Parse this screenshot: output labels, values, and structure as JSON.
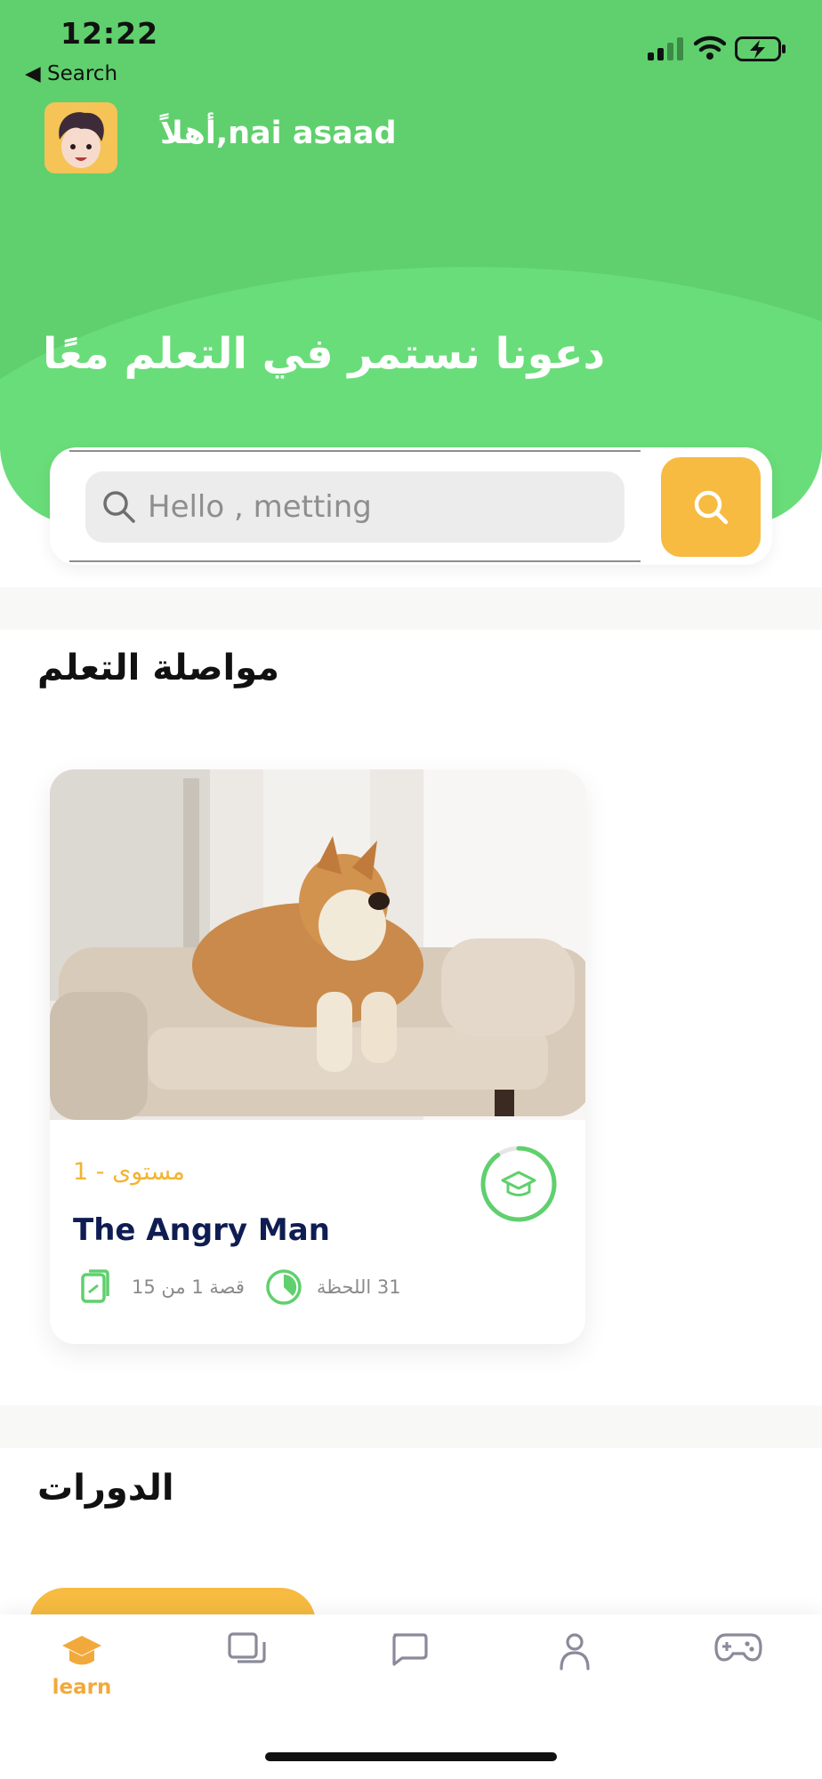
{
  "status_bar": {
    "time": "12:22",
    "back_label": "◀ Search"
  },
  "header": {
    "greeting": "أهلاً,nai asaad",
    "title": "دعونا نستمر في التعلم معًا"
  },
  "search": {
    "placeholder": "Hello , metting"
  },
  "continue_learning": {
    "title": "مواصلة التعلم",
    "course": {
      "level": "مستوى - 1",
      "title": "The Angry Man",
      "stories": "قصة 1 من 15",
      "duration": "31 اللحظة",
      "progress": 0.1
    }
  },
  "courses": {
    "title": "الدورات"
  },
  "tabbar": {
    "items": [
      {
        "label": "learn",
        "icon": "graduation-cap-icon",
        "active": true
      },
      {
        "label": "",
        "icon": "folders-icon",
        "active": false
      },
      {
        "label": "",
        "icon": "chat-icon",
        "active": false
      },
      {
        "label": "",
        "icon": "profile-icon",
        "active": false
      },
      {
        "label": "",
        "icon": "gamepad-icon",
        "active": false
      }
    ]
  },
  "colors": {
    "green": "#5fd06d",
    "accent": "#f6bb40",
    "navy": "#0f1d52"
  }
}
